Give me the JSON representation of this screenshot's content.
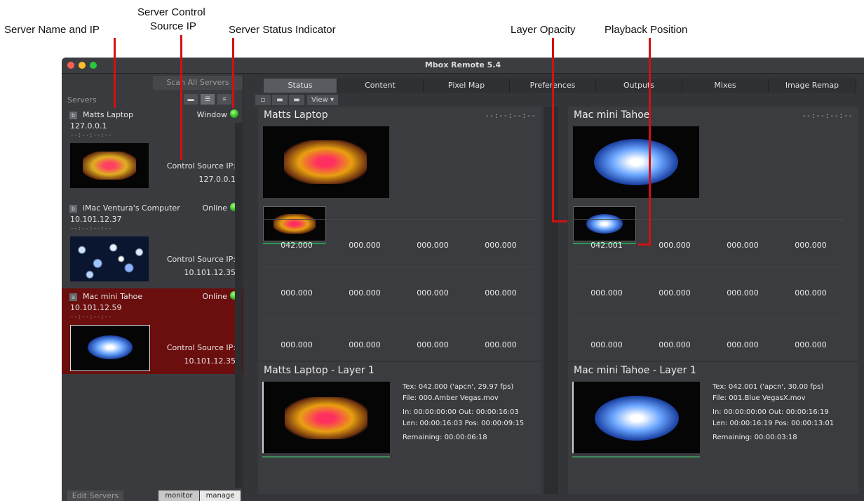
{
  "callouts": {
    "server_name_ip": "Server Name and IP",
    "server_control_source_ip_1": "Server Control",
    "server_control_source_ip_2": "Source IP",
    "server_status_indicator": "Server Status Indicator",
    "layer_opacity": "Layer Opacity",
    "playback_position": "Playback Position"
  },
  "window": {
    "title": "Mbox Remote 5.4"
  },
  "sidebar": {
    "scan_button": "Scan All Servers",
    "servers_label": "Servers",
    "servers": [
      {
        "badge": "b",
        "name": "Matts Laptop",
        "ip": "127.0.0.1",
        "timecode": "--:--:--:--",
        "status": "Window",
        "control_label": "Control Source IP:",
        "control_ip": "127.0.0.1",
        "selected": false
      },
      {
        "badge": "b",
        "name": "iMac Ventura's Computer",
        "ip": "10.101.12.37",
        "timecode": "--:--:--:--",
        "status": "Online",
        "control_label": "Control Source IP:",
        "control_ip": "10.101.12.35",
        "selected": false
      },
      {
        "badge": "a",
        "name": "Mac mini Tahoe",
        "ip": "10.101.12.59",
        "timecode": "--:--:--:--",
        "status": "Online",
        "control_label": "Control Source IP:",
        "control_ip": "10.101.12.35",
        "selected": true
      }
    ],
    "edit_button": "Edit Servers",
    "modes": [
      "monitor",
      "manage"
    ]
  },
  "tabs": [
    "Status",
    "Content",
    "Pixel Map",
    "Preferences",
    "Outputs",
    "Mixes",
    "Image Remap"
  ],
  "active_tab": "Status",
  "toolbar": {
    "view_label": "View"
  },
  "panels": [
    {
      "title": "Matts Laptop",
      "timecode": "--:--:--:--",
      "layer_values": [
        "042.000",
        "000.000",
        "000.000",
        "000.000",
        "000.000",
        "000.000",
        "000.000",
        "000.000",
        "000.000",
        "000.000",
        "000.000",
        "000.000"
      ],
      "layer_opacity": 1.0,
      "layer_title": "Matts Laptop - Layer 1",
      "tex": "Tex: 042.000 ('apcn', 29.97 fps)",
      "file": "File: 000.Amber Vegas.mov",
      "in_out": "In:   00:00:00:00   Out: 00:00:16:03",
      "len_pos": "Len: 00:00:16:03   Pos: 00:00:09:15",
      "remaining": "Remaining: 00:00:06:18",
      "playback_position": 0.6
    },
    {
      "title": "Mac mini Tahoe",
      "timecode": "--:--:--:--",
      "layer_values": [
        "042.001",
        "000.000",
        "000.000",
        "000.000",
        "000.000",
        "000.000",
        "000.000",
        "000.000",
        "000.000",
        "000.000",
        "000.000",
        "000.000"
      ],
      "layer_opacity": 1.0,
      "layer_title": "Mac mini Tahoe - Layer 1",
      "tex": "Tex: 042.001 ('apcn', 30.00 fps)",
      "file": "File: 001.Blue VegasX.mov",
      "in_out": "In:   00:00:00:00   Out: 00:00:16:19",
      "len_pos": "Len: 00:00:16:19   Pos: 00:00:13:01",
      "remaining": "Remaining: 00:00:03:18",
      "playback_position": 0.8
    }
  ],
  "colors": {
    "selected_server": "#6b0e0e",
    "status_led": "#2fb81e",
    "progress": "#2a9a52",
    "callout_line": "#d41010"
  }
}
